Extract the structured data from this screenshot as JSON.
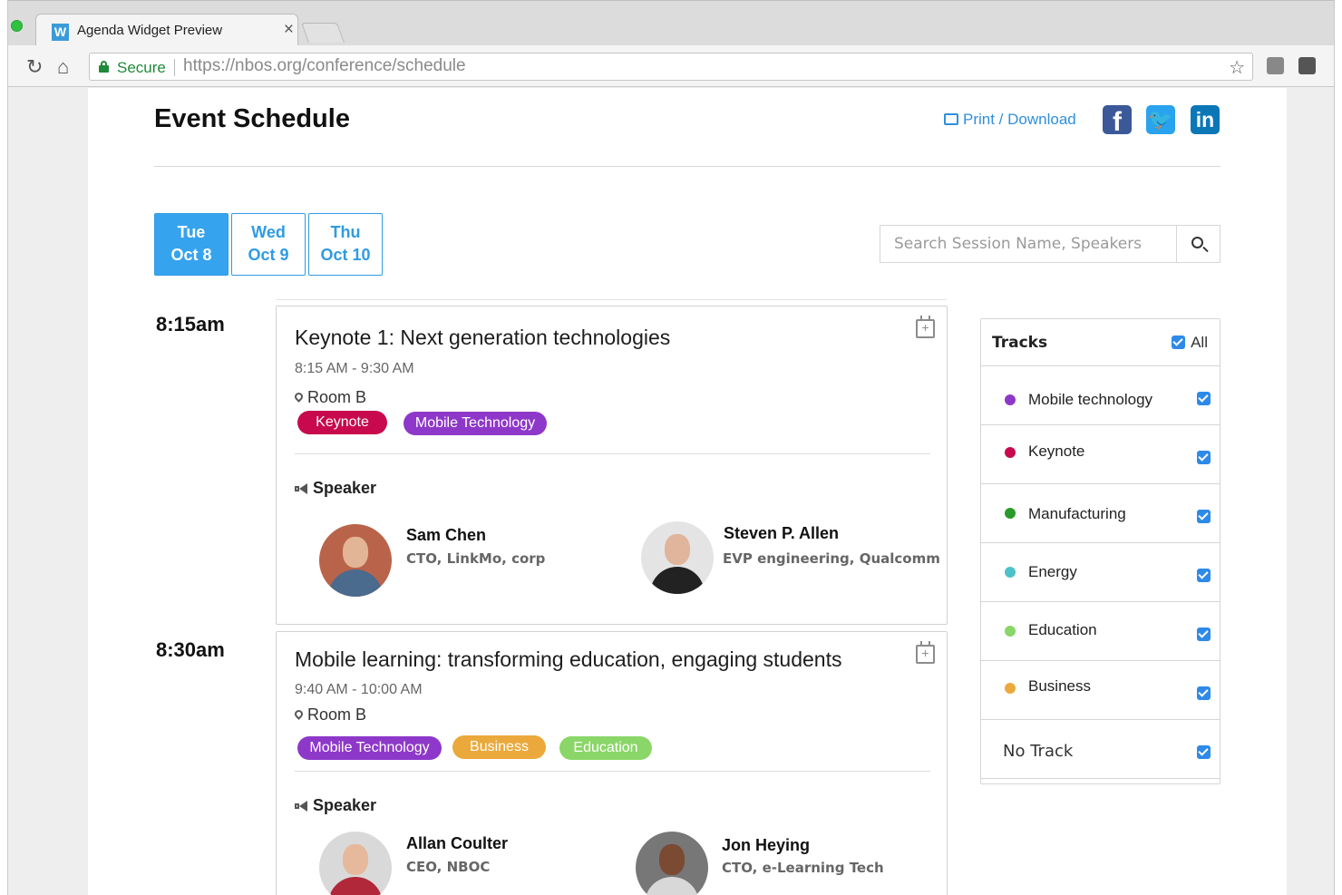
{
  "browser": {
    "tab_title": "Agenda Widget Preview",
    "favicon_letter": "W",
    "tab_close": "×",
    "secure_label": "Secure",
    "url": "https://nbos.org/conference/schedule"
  },
  "header": {
    "title": "Event Schedule",
    "print_link": "Print / Download",
    "social": [
      "facebook-icon",
      "twitter-icon",
      "linkedin-icon"
    ]
  },
  "days": [
    {
      "day": "Tue",
      "date": "Oct 8",
      "active": true
    },
    {
      "day": "Wed",
      "date": "Oct 9",
      "active": false
    },
    {
      "day": "Thu",
      "date": "Oct 10",
      "active": false
    }
  ],
  "search": {
    "placeholder": "Search Session Name, Speakers"
  },
  "sessions": [
    {
      "slot": "8:15am",
      "title": "Keynote 1: Next generation technologies",
      "time": "8:15 AM - 9:30 AM",
      "room": "Room B",
      "tags": [
        {
          "label": "Keynote",
          "color": "#c8094d"
        },
        {
          "label": "Mobile Technology",
          "color": "#8e38c9"
        }
      ],
      "speaker_heading": "Speaker",
      "speakers": [
        {
          "name": "Sam Chen",
          "role": "CTO, LinkMo, corp"
        },
        {
          "name": "Steven P. Allen",
          "role": "EVP engineering, Qualcomm"
        }
      ]
    },
    {
      "slot": "8:30am",
      "title": "Mobile learning: transforming education, engaging students",
      "time": "9:40 AM - 10:00 AM",
      "room": "Room B",
      "tags": [
        {
          "label": "Mobile Technology",
          "color": "#8e38c9"
        },
        {
          "label": "Business",
          "color": "#eba93b"
        },
        {
          "label": "Education",
          "color": "#8ad668"
        }
      ],
      "speaker_heading": "Speaker",
      "speakers": [
        {
          "name": "Allan Coulter",
          "role": "CEO, NBOC"
        },
        {
          "name": "Jon Heying",
          "role": "CTO, e-Learning Tech"
        }
      ]
    }
  ],
  "tracks": {
    "title": "Tracks",
    "all_label": "All",
    "all_checked": true,
    "items": [
      {
        "label": "Mobile technology",
        "color": "#8e38c9",
        "checked": true
      },
      {
        "label": "Keynote",
        "color": "#c8094d",
        "checked": true
      },
      {
        "label": "Manufacturing",
        "color": "#2a9a2a",
        "checked": true
      },
      {
        "label": "Energy",
        "color": "#4fc1c9",
        "checked": true
      },
      {
        "label": "Education",
        "color": "#8ad668",
        "checked": true
      },
      {
        "label": "Business",
        "color": "#eba93b",
        "checked": true
      }
    ],
    "no_track_label": "No Track",
    "no_track_checked": true
  }
}
